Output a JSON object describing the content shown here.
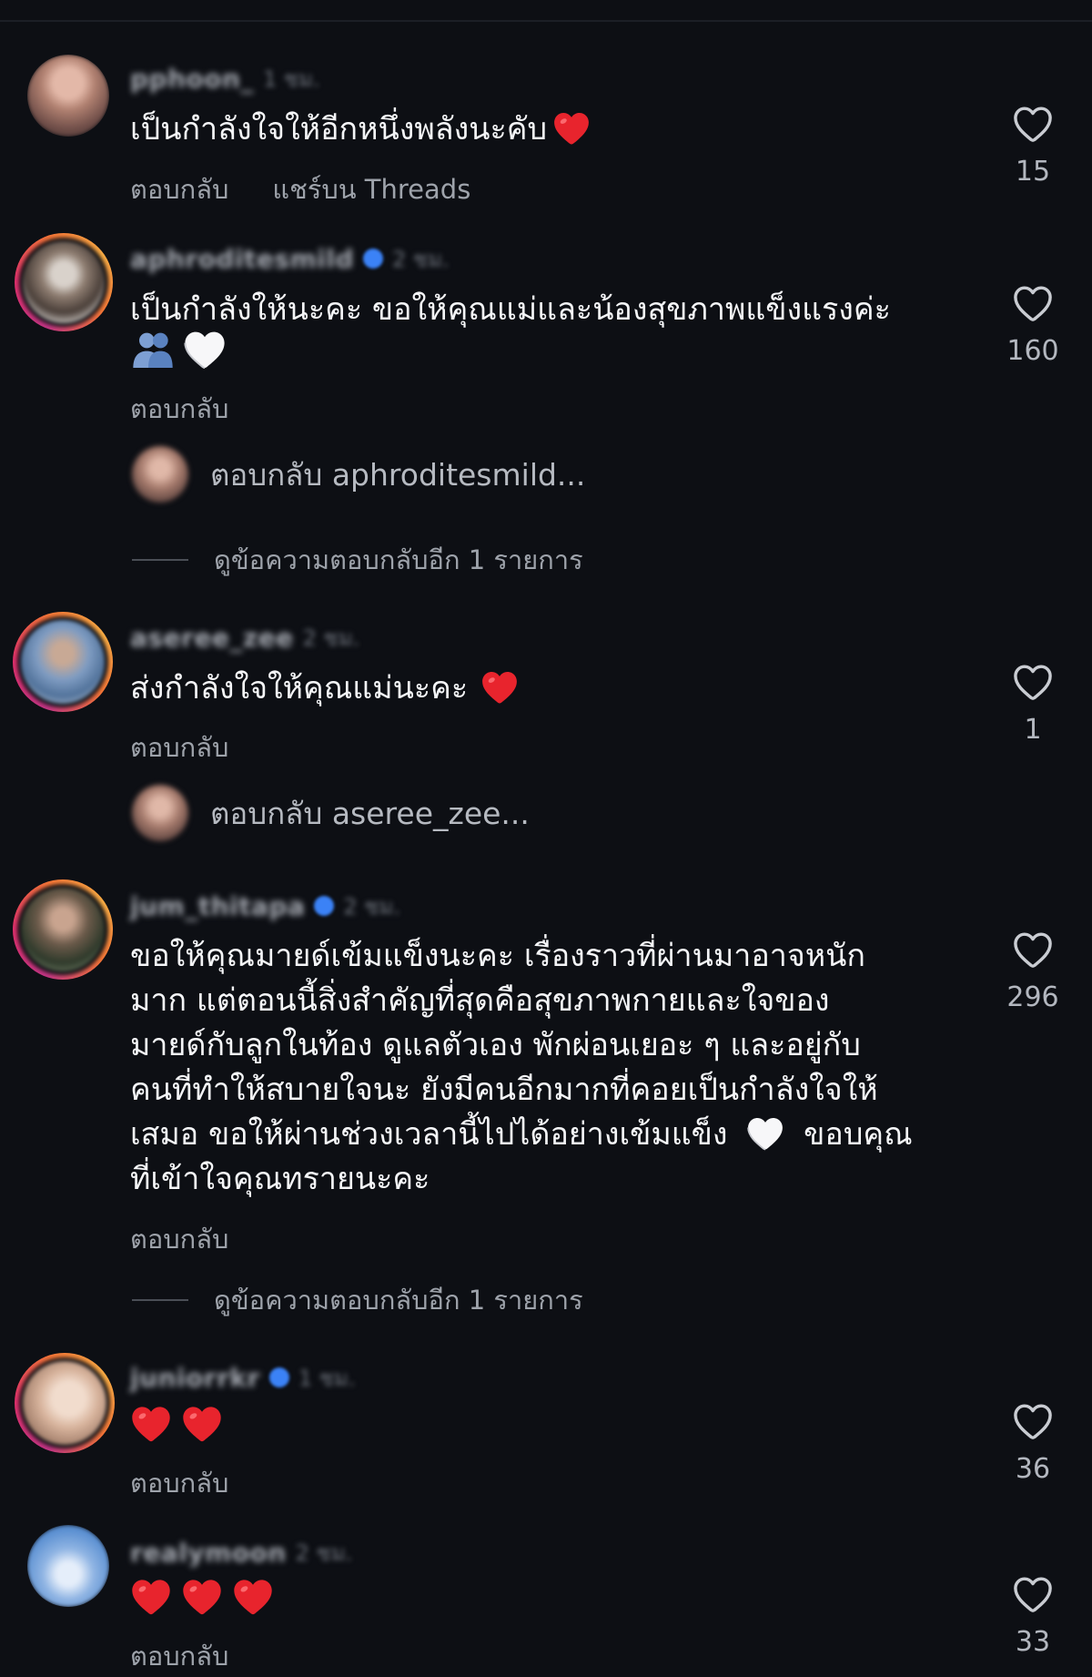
{
  "colors": {
    "background": "#0d0f14",
    "text": "#f4f5f7",
    "muted": "#9ea3ab",
    "heart_red": "#e8242d",
    "verified_blue": "#3b82f6"
  },
  "comments": [
    {
      "username": "pphoon_",
      "time": "1 ชม.",
      "verified": false,
      "text": "เป็นกำลังใจให้อีกหนึ่งพลังนะคับ",
      "reply_label": "ตอบกลับ",
      "share_label": "แชร์บน Threads",
      "likes": "15"
    },
    {
      "username": "aphroditesmild",
      "time": "2 ชม.",
      "verified": true,
      "text": "เป็นกำลังให้นะคะ ขอให้คุณแม่และน้องสุขภาพแข็งแรงค่ะ",
      "reply_label": "ตอบกลับ",
      "likes": "160",
      "reply_prompt": "ตอบกลับ aphroditesmild...",
      "more_replies": "ดูข้อความตอบกลับอีก 1 รายการ"
    },
    {
      "username": "aseree_zee",
      "time": "2 ชม.",
      "verified": false,
      "text": "ส่งกำลังใจให้คุณแม่นะคะ",
      "reply_label": "ตอบกลับ",
      "likes": "1",
      "reply_prompt": "ตอบกลับ aseree_zee..."
    },
    {
      "username": "jum_thitapa",
      "time": "2 ชม.",
      "verified": true,
      "text_lines": [
        "ขอให้คุณมายด์เข้มแข็งนะคะ เรื่องราวที่ผ่านมาอาจหนัก",
        "มาก แต่ตอนนี้สิ่งสำคัญที่สุดคือสุขภาพกายและใจของ",
        "มายด์กับลูกในท้อง ดูแลตัวเอง พักผ่อนเยอะ ๆ และอยู่กับ",
        "คนที่ทำให้สบายใจนะ ยังมีคนอีกมากที่คอยเป็นกำลังใจให้",
        "เสมอ ขอให้ผ่านช่วงเวลานี้ไปได้อย่างเข้มแข็ง",
        " ขอบคุณ",
        "ที่เข้าใจคุณทรายนะคะ"
      ],
      "reply_label": "ตอบกลับ",
      "likes": "296",
      "more_replies": "ดูข้อความตอบกลับอีก 1 รายการ"
    },
    {
      "username": "juniorrkr",
      "time": "1 ชม.",
      "verified": true,
      "reply_label": "ตอบกลับ",
      "likes": "36"
    },
    {
      "username": "realymoon",
      "time": "2 ชม.",
      "verified": false,
      "reply_label": "ตอบกลับ",
      "likes": "33"
    }
  ]
}
